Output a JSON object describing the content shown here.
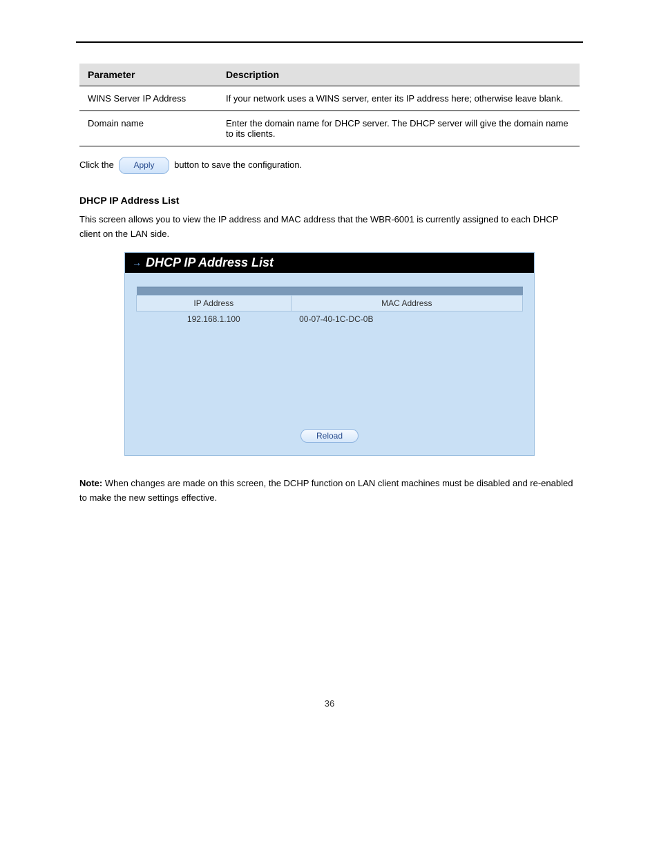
{
  "param_table": {
    "headers": [
      "Parameter",
      "Description"
    ],
    "rows": [
      {
        "param": "WINS Server IP Address",
        "desc": "If your network uses a WINS server, enter its IP address here; otherwise leave blank."
      },
      {
        "param": "Domain name",
        "desc": "Enter the domain name for DHCP server. The DHCP server will give the domain name to its clients."
      }
    ]
  },
  "apply_text_before": "Click the",
  "apply_button_label": "Apply",
  "apply_text_after": "button to save the configuration.",
  "section_heading": "DHCP IP Address List",
  "section_text": "This screen allows you to view the IP address and MAC address that the WBR-6001 is currently assigned to each DHCP client on the LAN side.",
  "panel_title": "DHCP IP Address List",
  "ip_table": {
    "headers": [
      "IP Address",
      "MAC Address"
    ],
    "rows": [
      {
        "ip": "192.168.1.100",
        "mac": "00-07-40-1C-DC-0B"
      }
    ]
  },
  "reload_label": "Reload",
  "note_label": "Note:",
  "note_text": "When changes are made on this screen, the DCHP function on LAN client machines must be disabled and re-enabled to make the new settings effective.",
  "footer": "36"
}
